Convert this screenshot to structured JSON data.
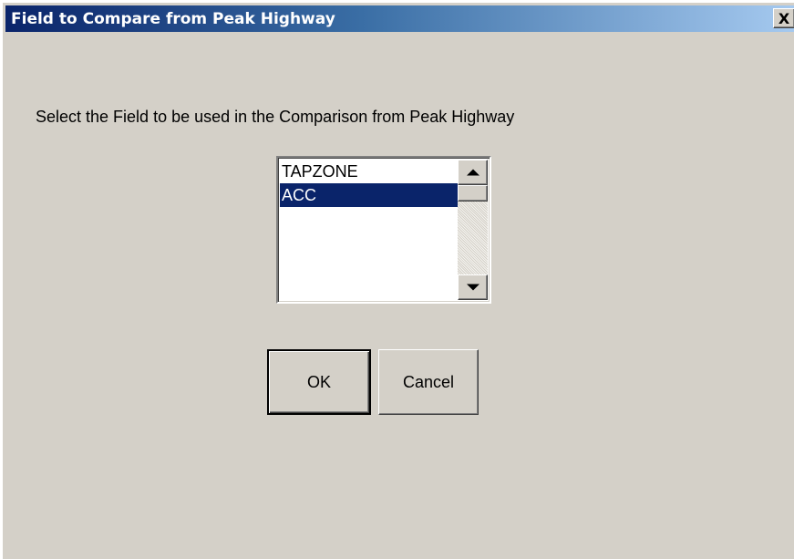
{
  "window": {
    "title": "Field to Compare from Peak Highway",
    "close_label": "X"
  },
  "dialog": {
    "prompt": "Select the Field to be used in the Comparison from Peak Highway",
    "fields": [
      {
        "label": "TAPZONE",
        "selected": false
      },
      {
        "label": "ACC",
        "selected": true
      }
    ],
    "selected_field": "ACC",
    "ok_label": "OK",
    "cancel_label": "Cancel"
  },
  "colors": {
    "dialog_background": "#d4d0c8",
    "title_gradient_start": "#0a246a",
    "title_gradient_end": "#a6caf0",
    "selection_background": "#0a246a",
    "selection_text": "#ffffff"
  },
  "icons": {
    "close": "close-icon",
    "scroll_up": "arrow-up-icon",
    "scroll_down": "arrow-down-icon"
  }
}
